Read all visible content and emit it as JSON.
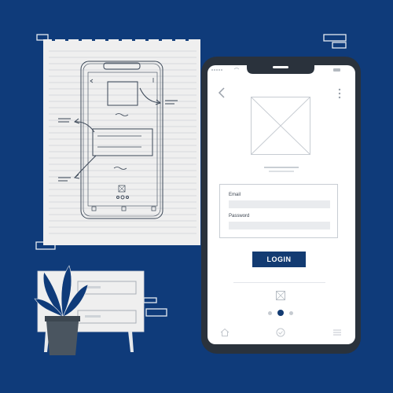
{
  "illustration": {
    "background_color": "#0f3b7a",
    "accent_color": "#133b72",
    "phone_frame_color": "#2a323c",
    "paper_color": "#efefef"
  },
  "login_screen": {
    "email_label": "Email",
    "password_label": "Password",
    "email_value": "",
    "password_value": "",
    "login_button_label": "LOGIN",
    "pagination": {
      "total": 3,
      "active": 2
    },
    "icons": [
      "back-icon",
      "more-vertical-icon",
      "image-placeholder-icon",
      "home-icon",
      "search-icon",
      "menu-icon"
    ]
  },
  "sketch_note": {
    "description_icons": [
      "wireframe-phone-sketch",
      "plant-icon",
      "dresser-icon"
    ]
  }
}
